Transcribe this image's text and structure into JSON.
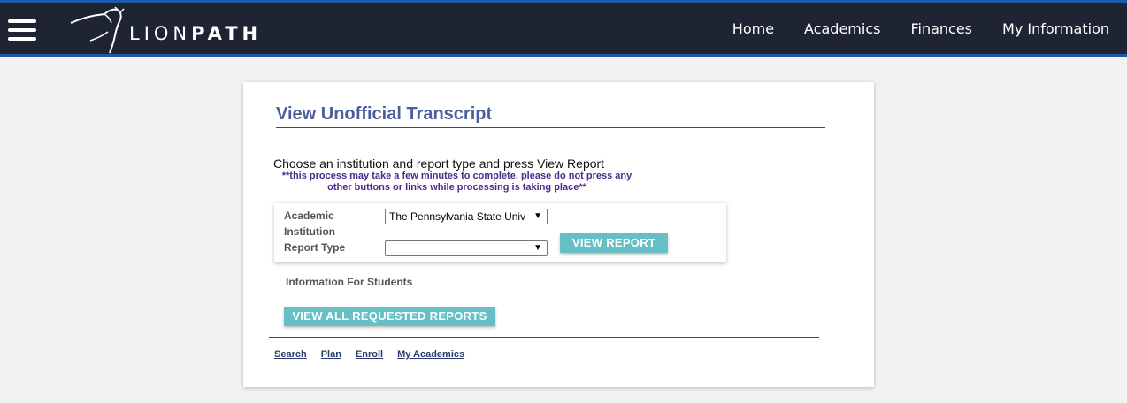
{
  "header": {
    "logo_left": "LION",
    "logo_right": "PATH",
    "nav": [
      "Home",
      "Academics",
      "Finances",
      "My Information"
    ]
  },
  "page": {
    "title": "View Unofficial Transcript",
    "instruction": "Choose an institution and report type and press View Report",
    "warning": "**this process may take a few minutes to complete. please do not press any other buttons or links while processing is taking place**"
  },
  "form": {
    "institution_label_1": "Academic",
    "institution_label_2": "Institution",
    "institution_value": "The Pennsylvania State Univ",
    "report_type_label": "Report Type",
    "report_type_value": "",
    "view_report_button": "VIEW REPORT"
  },
  "students": {
    "info_label": "Information For Students",
    "view_all_button": "VIEW ALL REQUESTED REPORTS"
  },
  "footer_links": [
    "Search",
    "Plan",
    "Enroll",
    "My Academics"
  ],
  "colors": {
    "header_bg": "#1e2431",
    "header_accent": "#1a5aa8",
    "title": "#4b5f9e",
    "button": "#65bfc4",
    "warning": "#4a2a8a"
  }
}
